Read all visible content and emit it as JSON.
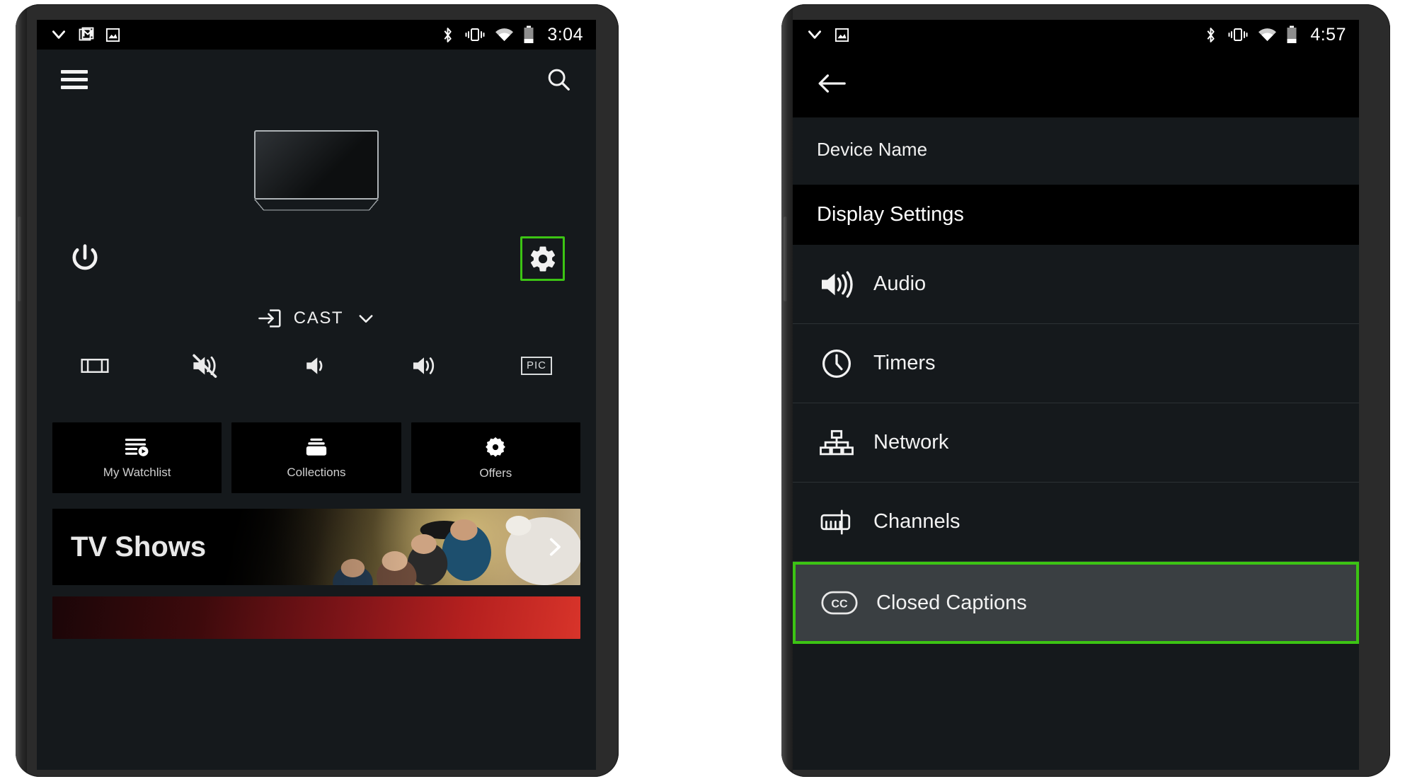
{
  "accent_green": "#3cc414",
  "left_phone": {
    "status_bar": {
      "time": "3:04",
      "left_icons": [
        "chevron-down-icon",
        "gmail-icon",
        "image-icon"
      ],
      "right_icons": [
        "bluetooth-icon",
        "vibrate-icon",
        "wifi-icon",
        "battery-icon"
      ]
    },
    "app_bar": {
      "menu_icon": "hamburger-menu-icon",
      "search_icon": "search-icon"
    },
    "remote": {
      "device_preview": "tv-illustration",
      "power_label": "power-icon",
      "settings_label": "gear-icon",
      "settings_highlighted": true,
      "cast_label": "CAST",
      "cast_icon": "input-source-icon",
      "cast_dropdown_icon": "chevron-down-icon",
      "controls": [
        {
          "name": "aspect-ratio-icon"
        },
        {
          "name": "volume-mute-icon"
        },
        {
          "name": "volume-down-icon"
        },
        {
          "name": "volume-up-icon"
        },
        {
          "name": "picture-mode-icon",
          "label": "PIC"
        }
      ]
    },
    "cards": [
      {
        "label": "My Watchlist",
        "icon": "playlist-play-icon"
      },
      {
        "label": "Collections",
        "icon": "collections-icon"
      },
      {
        "label": "Offers",
        "icon": "offers-badge-icon"
      }
    ],
    "banner": {
      "title": "TV Shows",
      "chevron_icon": "chevron-right-icon"
    }
  },
  "right_phone": {
    "status_bar": {
      "time": "4:57",
      "left_icons": [
        "chevron-down-icon",
        "image-icon"
      ],
      "right_icons": [
        "bluetooth-icon",
        "vibrate-icon",
        "wifi-icon",
        "battery-icon"
      ]
    },
    "app_bar": {
      "back_icon": "arrow-back-icon"
    },
    "device_name_label": "Device Name",
    "section_header": "Display Settings",
    "items": [
      {
        "label": "Audio",
        "icon": "speaker-icon",
        "highlighted": false
      },
      {
        "label": "Timers",
        "icon": "clock-icon",
        "highlighted": false
      },
      {
        "label": "Network",
        "icon": "network-hierarchy-icon",
        "highlighted": false
      },
      {
        "label": "Channels",
        "icon": "channels-tuner-icon",
        "highlighted": false
      },
      {
        "label": "Closed Captions",
        "icon": "closed-captions-icon",
        "highlighted": true
      }
    ]
  }
}
